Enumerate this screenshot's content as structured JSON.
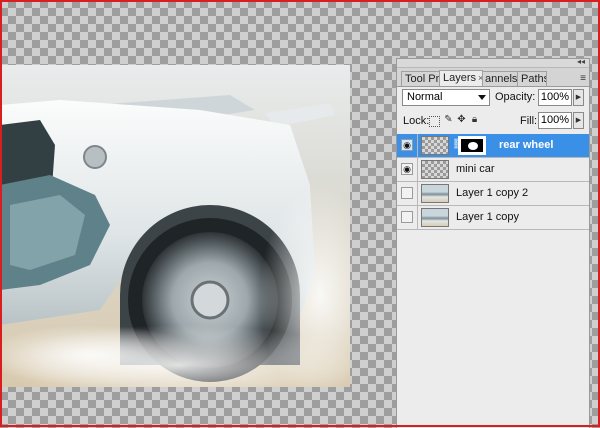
{
  "panel": {
    "tabs": [
      {
        "label": "Tool Pr",
        "close": ""
      },
      {
        "label": "Layers",
        "close": "×"
      },
      {
        "label": "annels",
        "close": ""
      },
      {
        "label": "Paths",
        "close": ""
      }
    ],
    "blend_mode": "Normal",
    "opacity_label": "Opacity:",
    "opacity_value": "100%",
    "lock_label": "Lock:",
    "fill_label": "Fill:",
    "fill_value": "100%",
    "layers": [
      {
        "name": "rear wheel",
        "visible": true,
        "selected": true,
        "has_mask": true
      },
      {
        "name": "mini car",
        "visible": true,
        "selected": false,
        "has_mask": false
      },
      {
        "name": "Layer 1 copy 2",
        "visible": false,
        "selected": false,
        "has_mask": false
      },
      {
        "name": "Layer 1 copy",
        "visible": false,
        "selected": false,
        "has_mask": false
      }
    ]
  },
  "icons": {
    "eye": "eye-icon",
    "link": "chain-link-icon",
    "panel_menu": "panel-menu-icon",
    "collapse": "collapse-arrows-icon"
  },
  "colors": {
    "selection": "#3a8fe6",
    "frame_border": "#d81e1e"
  }
}
